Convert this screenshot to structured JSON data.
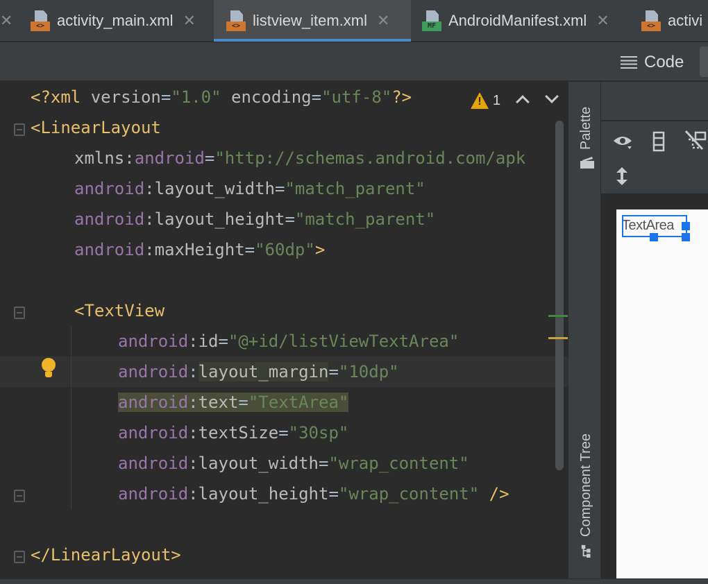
{
  "tabs": [
    {
      "label": "activity_main.xml",
      "icon": "xml-file-icon",
      "badge": "<>",
      "active": false
    },
    {
      "label": "listview_item.xml",
      "icon": "xml-file-icon",
      "badge": "<>",
      "active": true
    },
    {
      "label": "AndroidManifest.xml",
      "icon": "manifest-file-icon",
      "badge": "MF",
      "active": false
    },
    {
      "label": "activi",
      "icon": "xml-file-icon",
      "badge": "<>",
      "active": false
    }
  ],
  "toolbar": {
    "code_label": "Code"
  },
  "inspection": {
    "warnings": "1"
  },
  "code": {
    "l1": {
      "open": "<?",
      "tag": "xml",
      "a1": "version",
      "v1": "\"1.0\"",
      "a2": "encoding",
      "v2": "\"utf-8\"",
      "close": "?>"
    },
    "l2": {
      "tag": "<LinearLayout"
    },
    "l3": {
      "attr": "xmlns",
      "ns": "android",
      "val": "\"http://schemas.android.com/apk"
    },
    "l4": {
      "ns": "android",
      "attr": "layout_width",
      "val": "\"match_parent\""
    },
    "l5": {
      "ns": "android",
      "attr": "layout_height",
      "val": "\"match_parent\""
    },
    "l6": {
      "ns": "android",
      "attr": "maxHeight",
      "val": "\"60dp\"",
      "close": ">"
    },
    "l8": {
      "tag": "<TextView"
    },
    "l9": {
      "ns": "android",
      "attr": "id",
      "val": "\"@+id/listViewTextArea\""
    },
    "l10": {
      "ns": "android",
      "attr": "layout_margin",
      "val": "\"10dp\""
    },
    "l11": {
      "ns": "android",
      "attr": "text",
      "val": "\"TextArea\""
    },
    "l12": {
      "ns": "android",
      "attr": "textSize",
      "val": "\"30sp\""
    },
    "l13": {
      "ns": "android",
      "attr": "layout_width",
      "val": "\"wrap_content\""
    },
    "l14": {
      "ns": "android",
      "attr": "layout_height",
      "val": "\"wrap_content\"",
      "close": "/>"
    },
    "l16": {
      "tag": "</LinearLayout>"
    }
  },
  "side_panel": {
    "palette_label": "Palette",
    "component_tree_label": "Component Tree"
  },
  "preview": {
    "text": "TextArea"
  },
  "colors": {
    "tag": "#e8bf6a",
    "namespace": "#9876aa",
    "value": "#6a8759",
    "attribute": "#bababa",
    "selection": "#1a73e8"
  }
}
